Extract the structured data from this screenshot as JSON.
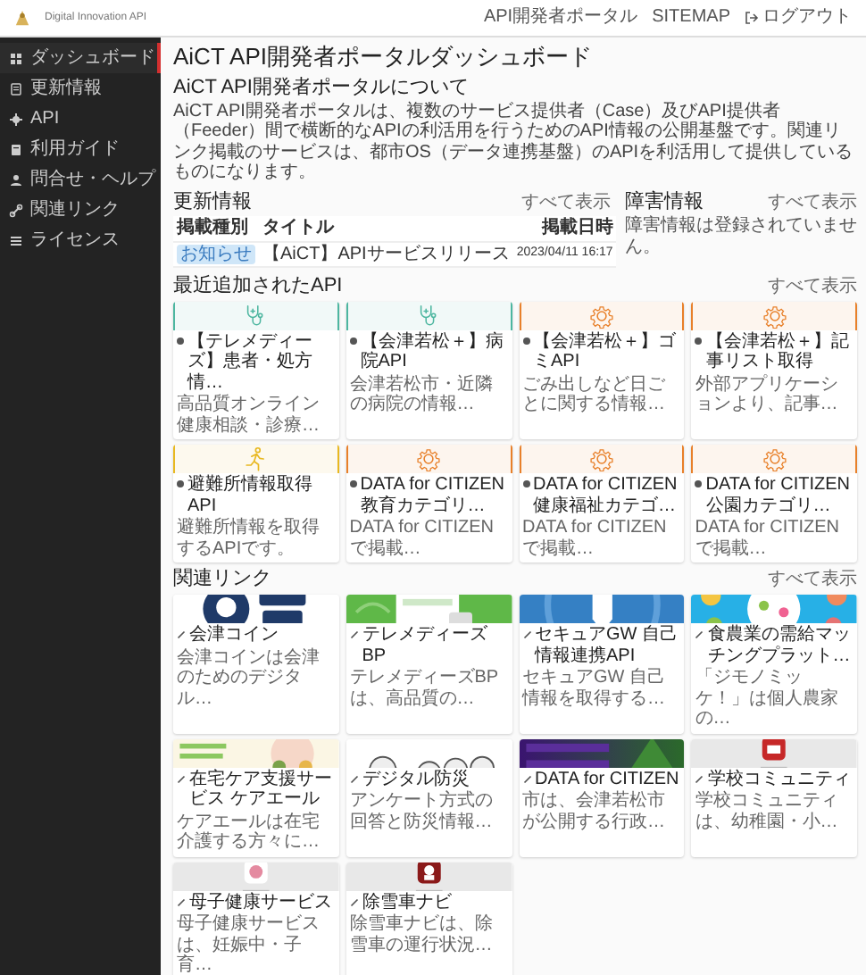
{
  "header": {
    "logo_text": "Digital Innovation API",
    "links": [
      "API開発者ポータル",
      "SITEMAP"
    ],
    "logout": "ログアウト"
  },
  "sidebar": {
    "items": [
      {
        "label": "ダッシュボード",
        "selected": true
      },
      {
        "label": "更新情報",
        "selected": false
      },
      {
        "label": "API",
        "selected": false
      },
      {
        "label": "利用ガイド",
        "selected": false
      },
      {
        "label": "問合せ・ヘルプ",
        "selected": false
      },
      {
        "label": "関連リンク",
        "selected": false
      },
      {
        "label": "ライセンス",
        "selected": false
      }
    ]
  },
  "page_title": "AiCT API開発者ポータルダッシュボード",
  "about": {
    "heading": "AiCT API開発者ポータルについて",
    "text": "AiCT API開発者ポータルは、複数のサービス提供者（Case）及びAPI提供者（Feeder）間で横断的なAPIの利活用を行うためのAPI情報の公開基盤です。関連リンク掲載のサービスは、都市OS（データ連携基盤）のAPIを利活用して提供しているものになります。"
  },
  "updates": {
    "heading": "更新情報",
    "more": "すべて表示",
    "columns": [
      "掲載種別",
      "タイトル",
      "掲載日時"
    ],
    "rows": [
      {
        "tag": "お知らせ",
        "title": "【AiCT】APIサービスリリース",
        "date": "2023/04/11 16:17"
      }
    ]
  },
  "incidents": {
    "heading": "障害情報",
    "more": "すべて表示",
    "message": "障害情報は登録されていません。"
  },
  "recent_apis": {
    "heading": "最近追加されたAPI",
    "more": "すべて表示",
    "cards": [
      {
        "kind": "medical",
        "color": "#4db6a0",
        "title": "【テレメディーズ】患者・処方情…",
        "description": "高品質オンライン健康相談・診療…"
      },
      {
        "kind": "medical",
        "color": "#4db6a0",
        "title": "【会津若松＋】病院API",
        "description": "会津若松市・近隣の病院の情報…"
      },
      {
        "kind": "data",
        "color": "#e8802a",
        "title": "【会津若松＋】ゴミAPI",
        "description": "ごみ出しなど日ごとに関する情報…"
      },
      {
        "kind": "data",
        "color": "#e8802a",
        "title": "【会津若松＋】記事リスト取得",
        "description": "外部アプリケーションより、記事…"
      },
      {
        "kind": "safety",
        "color": "#e8b820",
        "title": "避難所情報取得API",
        "description": "避難所情報を取得するAPIです。"
      },
      {
        "kind": "data",
        "color": "#e8802a",
        "title": "DATA for CITIZEN 教育カテゴリ…",
        "description": "DATA for CITIZENで掲載…"
      },
      {
        "kind": "data",
        "color": "#e8802a",
        "title": "DATA for CITIZEN 健康福祉カテゴ…",
        "description": "DATA for CITIZENで掲載…"
      },
      {
        "kind": "data",
        "color": "#e8802a",
        "title": "DATA for CITIZEN 公園カテゴリ…",
        "description": "DATA for CITIZENで掲載…"
      }
    ]
  },
  "related_links": {
    "heading": "関連リンク",
    "more": "すべて表示",
    "cards": [
      {
        "title": "会津コイン",
        "description": "会津コインは会津のためのデジタル…"
      },
      {
        "title": "テレメディーズBP",
        "description": "テレメディーズBPは、高品質の…"
      },
      {
        "title": "セキュアGW 自己情報連携API",
        "description": "セキュアGW 自己情報を取得する…"
      },
      {
        "title": "食農業の需給マッチングプラット…",
        "description": "「ジモノミッケ！」は個人農家の…"
      },
      {
        "title": "在宅ケア支援サービス ケアエール",
        "description": "ケアエールは在宅介護する方々に…"
      },
      {
        "title": "デジタル防災",
        "description": "アンケート方式の回答と防災情報…"
      },
      {
        "title": "DATA for CITIZEN",
        "description": "市は、会津若松市が公開する行政…"
      },
      {
        "title": "学校コミュニティ",
        "description": "学校コミュニティは、幼稚園・小…"
      },
      {
        "title": "母子健康サービス",
        "description": "母子健康サービスは、妊娠中・子育…"
      },
      {
        "title": "除雪車ナビ",
        "description": "除雪車ナビは、除雪車の運行状況…"
      }
    ]
  }
}
